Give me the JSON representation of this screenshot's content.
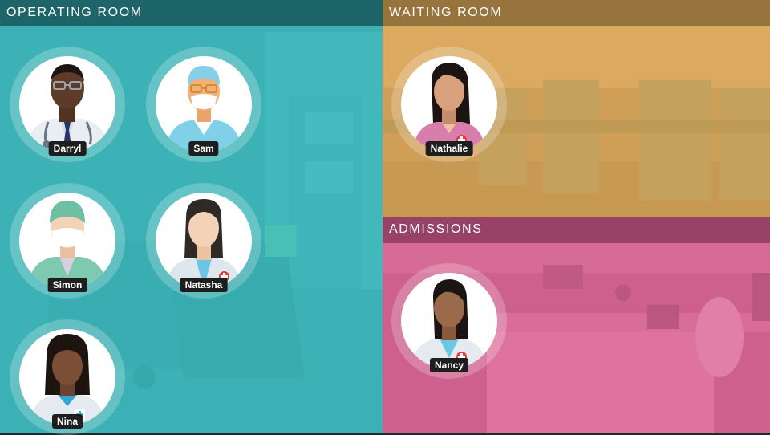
{
  "rooms": {
    "operating": {
      "title": "OPERATING ROOM",
      "tint": "#3fc2c6"
    },
    "waiting": {
      "title": "WAITING ROOM",
      "tint": "#e8b05a"
    },
    "admissions": {
      "title": "ADMISSIONS",
      "tint": "#e06a99"
    }
  },
  "staff": {
    "darryl": {
      "name": "Darryl"
    },
    "sam": {
      "name": "Sam"
    },
    "simon": {
      "name": "Simon"
    },
    "natasha": {
      "name": "Natasha"
    },
    "nina": {
      "name": "Nina"
    },
    "nathalie": {
      "name": "Nathalie"
    },
    "nancy": {
      "name": "Nancy"
    }
  }
}
